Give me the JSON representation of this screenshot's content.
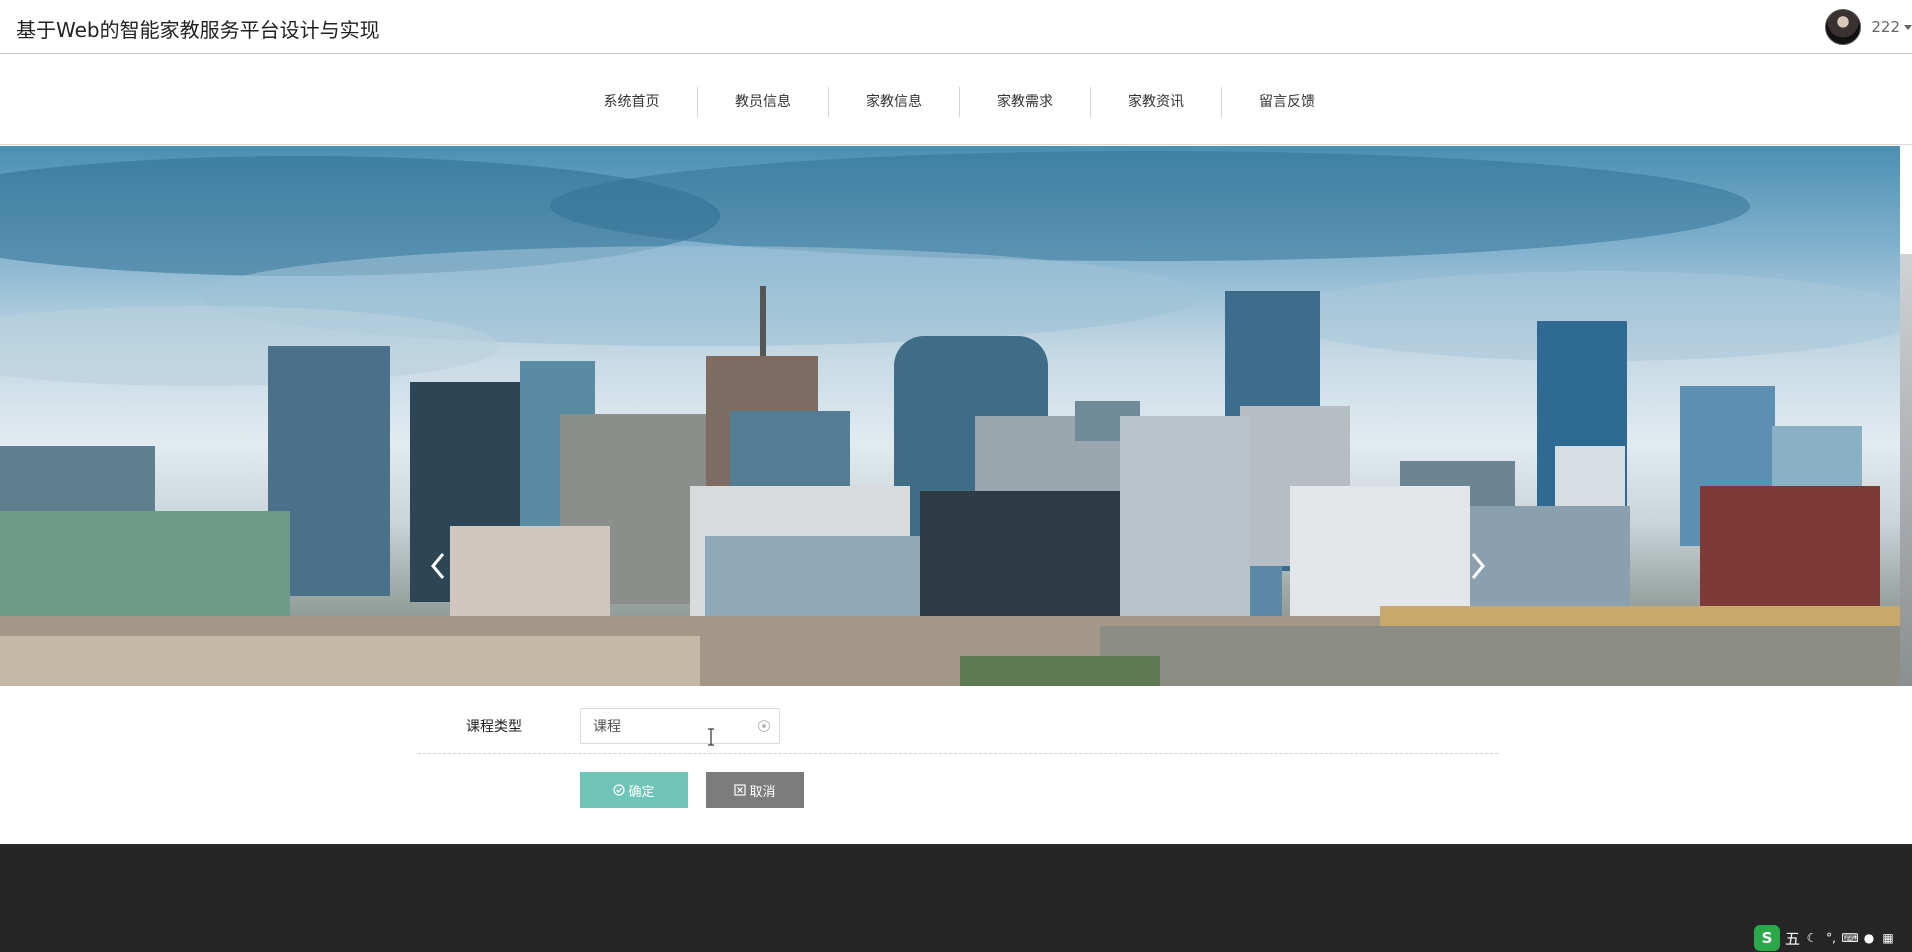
{
  "header": {
    "title": "基于Web的智能家教服务平台设计与实现",
    "user_name": "222"
  },
  "nav": {
    "items": [
      {
        "label": "系统首页"
      },
      {
        "label": "教员信息"
      },
      {
        "label": "家教信息"
      },
      {
        "label": "家教需求"
      },
      {
        "label": "家教资讯"
      },
      {
        "label": "留言反馈"
      }
    ]
  },
  "banner": {
    "slide_count": 2,
    "active_slide": 1
  },
  "form": {
    "course_type_label": "课程类型",
    "course_type_value": "课程"
  },
  "buttons": {
    "confirm_label": "确定",
    "cancel_label": "取消"
  },
  "ime": {
    "mode": "五",
    "logo": "S"
  },
  "colors": {
    "confirm": "#6fc5b8",
    "cancel": "#7c7c7c",
    "footer": "#262626"
  }
}
